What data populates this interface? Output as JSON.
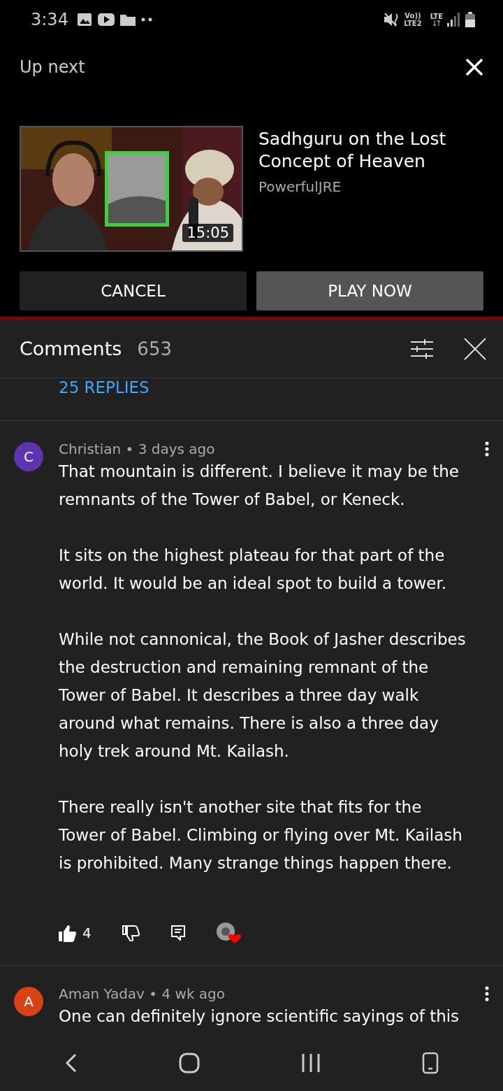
{
  "status_bar": {
    "time": "3:34",
    "network_top": "Vo))",
    "network_bottom": "LTE2",
    "lte": "LTE"
  },
  "up_next": {
    "heading": "Up next",
    "video": {
      "kind": "picture",
      "duration": "15:05",
      "title": "Sadhguru on the Lost Concept of Heaven",
      "channel": "PowerfulJRE"
    },
    "buttons": [
      {
        "label": "CANCEL",
        "kind": "cancel"
      },
      {
        "label": "PLAY NOW",
        "kind": "play"
      }
    ]
  },
  "comments": {
    "title": "Comments",
    "count": "653",
    "replies_link": "25 REPLIES",
    "items": [
      {
        "avatar_letter": "C",
        "color": "#5e35b1",
        "byline": "Christian • 3 days ago",
        "paragraphs": [
          "That mountain is different.  I believe it may be the remnants of the Tower of Babel, or Keneck.",
          "It sits on the highest plateau for that part of the world.  It would be an ideal spot to build a tower.",
          "While not cannonical, the Book of Jasher describes the destruction and remaining remnant of the Tower of Babel.  It describes a three day walk around what remains.  There is also a three day holy trek around Mt. Kailash.",
          "There really isn't another site that fits for the Tower of Babel.  Climbing or flying over Mt. Kailash is prohibited.  Many strange things happen there."
        ],
        "likes": "4",
        "liked": true,
        "hearted": true
      },
      {
        "avatar_letter": "A",
        "color": "#d84315",
        "byline": "Aman Yadav • 4 wk ago",
        "paragraphs": [
          "One can definitely ignore scientific sayings of this"
        ]
      }
    ]
  }
}
